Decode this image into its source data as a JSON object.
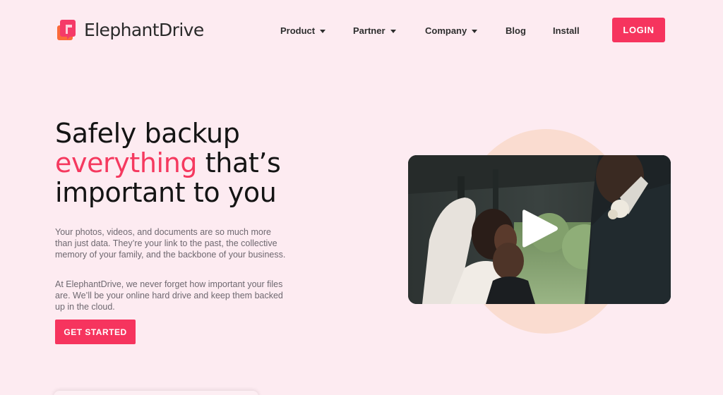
{
  "brand": {
    "name": "ElephantDrive",
    "logo_icon": "elephantdrive-logo-icon",
    "colors": {
      "accent": "#f6345e",
      "background": "#fdebf1",
      "blob": "#fadcd0",
      "text": "#141414"
    }
  },
  "nav": {
    "items": [
      {
        "label": "Product",
        "dropdown": true
      },
      {
        "label": "Partner",
        "dropdown": true
      },
      {
        "label": "Company",
        "dropdown": true
      },
      {
        "label": "Blog",
        "dropdown": false
      },
      {
        "label": "Install",
        "dropdown": false
      }
    ],
    "login_label": "LOGIN"
  },
  "hero": {
    "headline": {
      "line1": "Safely backup",
      "accent": "everything",
      "rest": " that’s",
      "line3": "important to you"
    },
    "paragraph1": "Your photos, videos, and documents are so much more than just data. They’re your link to the past, the collective memory of your family, and the backbone of your business.",
    "paragraph2": "At ElephantDrive, we never forget how important your files are. We’ll be your online hard drive and keep them backed up in the cloud.",
    "cta_label": "GET STARTED"
  },
  "video": {
    "play_icon": "play-icon"
  }
}
